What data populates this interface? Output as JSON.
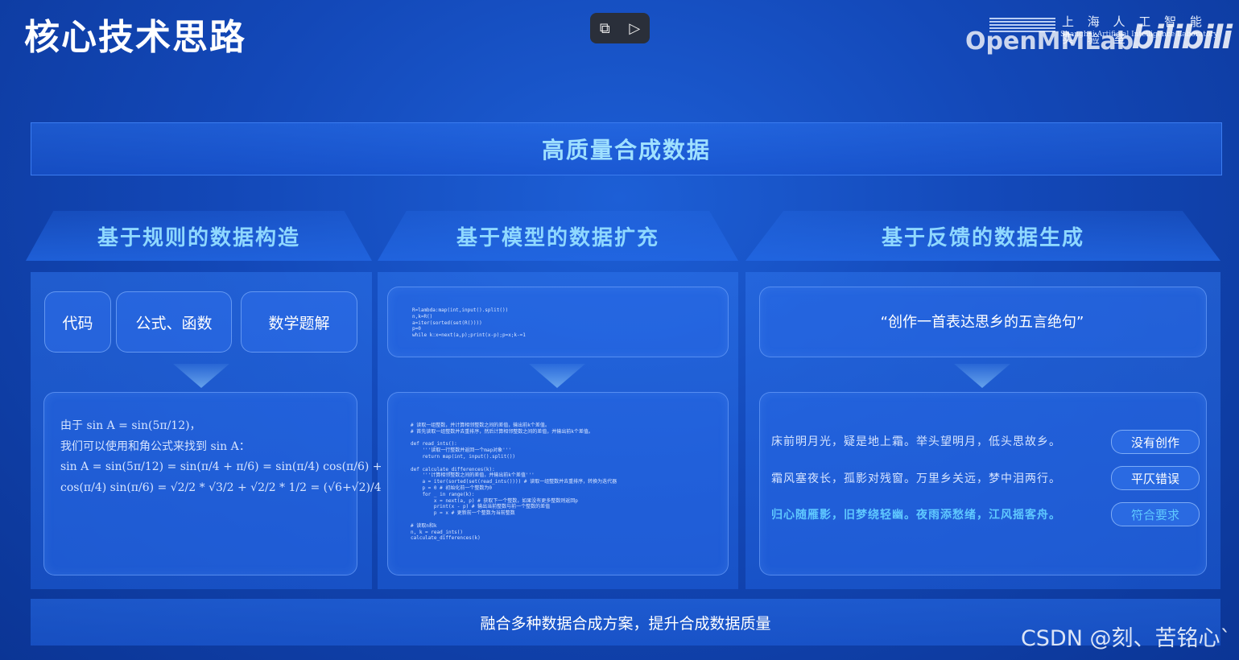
{
  "page_title": "核心技术思路",
  "player": {
    "pip_icon": "pip-icon",
    "ai_icon": "ai-video-icon"
  },
  "brand": {
    "lab_cn": "上 海 人 工 智 能 实 验 室",
    "lab_en": "Shanghai Artificial Intelligence Laboratory",
    "openmmlab": "OpenMMLab",
    "bilibili": "bilibili"
  },
  "banner": "高质量合成数据",
  "columns": [
    {
      "title": "基于规则的数据构造"
    },
    {
      "title": "基于模型的数据扩充"
    },
    {
      "title": "基于反馈的数据生成"
    }
  ],
  "rule_chips": [
    "代码",
    "公式、函数",
    "数学题解"
  ],
  "math_lines": [
    "由于 sin A = sin(5π/12)，",
    "我们可以使用和角公式来找到 sin A：",
    "sin A = sin(5π/12) = sin(π/4 + π/6) = sin(π/4) cos(π/6) +",
    "cos(π/4) sin(π/6) = √2/2 * √3/2 + √2/2 * 1/2 = (√6+√2)/4"
  ],
  "code_top": "R=lambda:map(int,input().split())\nn,k=R()\na=iter(sorted(set(R())))\np=0\nwhile k:x=next(a,p);print(x-p);p=x;k-=1",
  "code_bottom": "# 读取一组整数，并计算相邻整数之间的差值，输出前k个差值。\n# 首先读取一组整数并去重排序，然后计算相邻整数之间的差值，并输出前k个差值。\n\ndef read_ints():\n    '''读取一行整数并返回一个map对象'''\n    return map(int, input().split())\n\ndef calculate_differences(k):\n    '''计算相邻整数之间的差值，并输出前k个差值'''\n    a = iter(sorted(set(read_ints()))) # 读取一组整数并去重排序，转换为迭代器\n    p = 0 # 初始化前一个整数为0\n    for _ in range(k):\n        x = next(a, p) # 获取下一个整数，如果没有更多整数则返回p\n        print(x - p) # 输出当前整数与前一个整数的差值\n        p = x # 更新前一个整数为当前整数\n\n# 读取n和k\nn, k = read_ints()\ncalculate_differences(k)",
  "poem_prompt": "“创作一首表达思乡的五言绝句”",
  "poems": [
    {
      "text": "床前明月光，疑是地上霜。举头望明月，低头思故乡。",
      "tag": "没有创作",
      "good": false
    },
    {
      "text": "霜风塞夜长，孤影对残窗。万里乡关远，梦中泪两行。",
      "tag": "平仄错误",
      "good": false
    },
    {
      "text": "归心随雁影，旧梦绕轻幽。夜雨添愁绪，江风摇客舟。",
      "tag": "符合要求",
      "good": true
    }
  ],
  "footer": "融合多种数据合成方案，提升合成数据质量",
  "watermark": "CSDN @刻、苦铭心`",
  "colors": {
    "accent_text": "#8fd8ff",
    "good": "#5fc8ff",
    "background": "#1348b8"
  }
}
